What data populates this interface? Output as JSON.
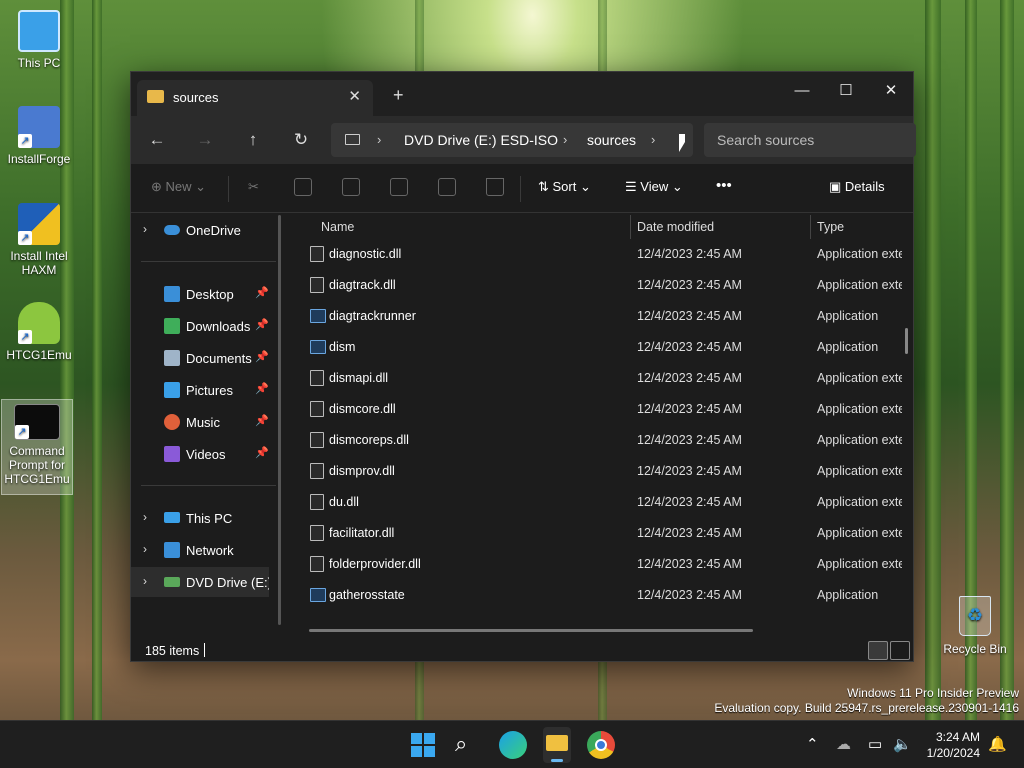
{
  "desktop": {
    "icons": [
      {
        "label": "This PC"
      },
      {
        "label": "InstallForge"
      },
      {
        "label": "Install Intel HAXM"
      },
      {
        "label": "HTCG1Emu"
      },
      {
        "label": "Command Prompt for HTCG1Emu"
      }
    ],
    "recycle_bin": "Recycle Bin",
    "watermark_line1": "Windows 11 Pro Insider Preview",
    "watermark_line2": "Evaluation copy. Build 25947.rs_prerelease.230901-1416"
  },
  "window": {
    "tab_title": "sources",
    "breadcrumb": [
      "DVD Drive (E:) ESD-ISO",
      "sources"
    ],
    "search_placeholder": "Search sources",
    "commands": {
      "new": "New",
      "sort": "Sort",
      "view": "View",
      "more": "•••",
      "details": "Details"
    },
    "nav": {
      "onedrive": "OneDrive",
      "quick": [
        {
          "label": "Desktop",
          "color": "#3a8fd8"
        },
        {
          "label": "Downloads",
          "color": "#3fae5a"
        },
        {
          "label": "Documents",
          "color": "#9fb4c8"
        },
        {
          "label": "Pictures",
          "color": "#3aa0e8"
        },
        {
          "label": "Music",
          "color": "#e0603a"
        },
        {
          "label": "Videos",
          "color": "#8a5ad8"
        }
      ],
      "this_pc": "This PC",
      "network": "Network",
      "dvd": "DVD Drive (E:) ESD-ISO"
    },
    "columns": {
      "name": "Name",
      "date": "Date modified",
      "type": "Type"
    },
    "files": [
      {
        "name": "diagnostic.dll",
        "date": "12/4/2023 2:45 AM",
        "type": "Application extension",
        "kind": "dll"
      },
      {
        "name": "diagtrack.dll",
        "date": "12/4/2023 2:45 AM",
        "type": "Application extension",
        "kind": "dll"
      },
      {
        "name": "diagtrackrunner",
        "date": "12/4/2023 2:45 AM",
        "type": "Application",
        "kind": "app"
      },
      {
        "name": "dism",
        "date": "12/4/2023 2:45 AM",
        "type": "Application",
        "kind": "app"
      },
      {
        "name": "dismapi.dll",
        "date": "12/4/2023 2:45 AM",
        "type": "Application extension",
        "kind": "dll"
      },
      {
        "name": "dismcore.dll",
        "date": "12/4/2023 2:45 AM",
        "type": "Application extension",
        "kind": "dll"
      },
      {
        "name": "dismcoreps.dll",
        "date": "12/4/2023 2:45 AM",
        "type": "Application extension",
        "kind": "dll"
      },
      {
        "name": "dismprov.dll",
        "date": "12/4/2023 2:45 AM",
        "type": "Application extension",
        "kind": "dll"
      },
      {
        "name": "du.dll",
        "date": "12/4/2023 2:45 AM",
        "type": "Application extension",
        "kind": "dll"
      },
      {
        "name": "facilitator.dll",
        "date": "12/4/2023 2:45 AM",
        "type": "Application extension",
        "kind": "dll"
      },
      {
        "name": "folderprovider.dll",
        "date": "12/4/2023 2:45 AM",
        "type": "Application extension",
        "kind": "dll"
      },
      {
        "name": "gatherosstate",
        "date": "12/4/2023 2:45 AM",
        "type": "Application",
        "kind": "app"
      }
    ],
    "status_count": "185 items"
  },
  "taskbar": {
    "time": "3:24 AM",
    "date": "1/20/2024"
  }
}
